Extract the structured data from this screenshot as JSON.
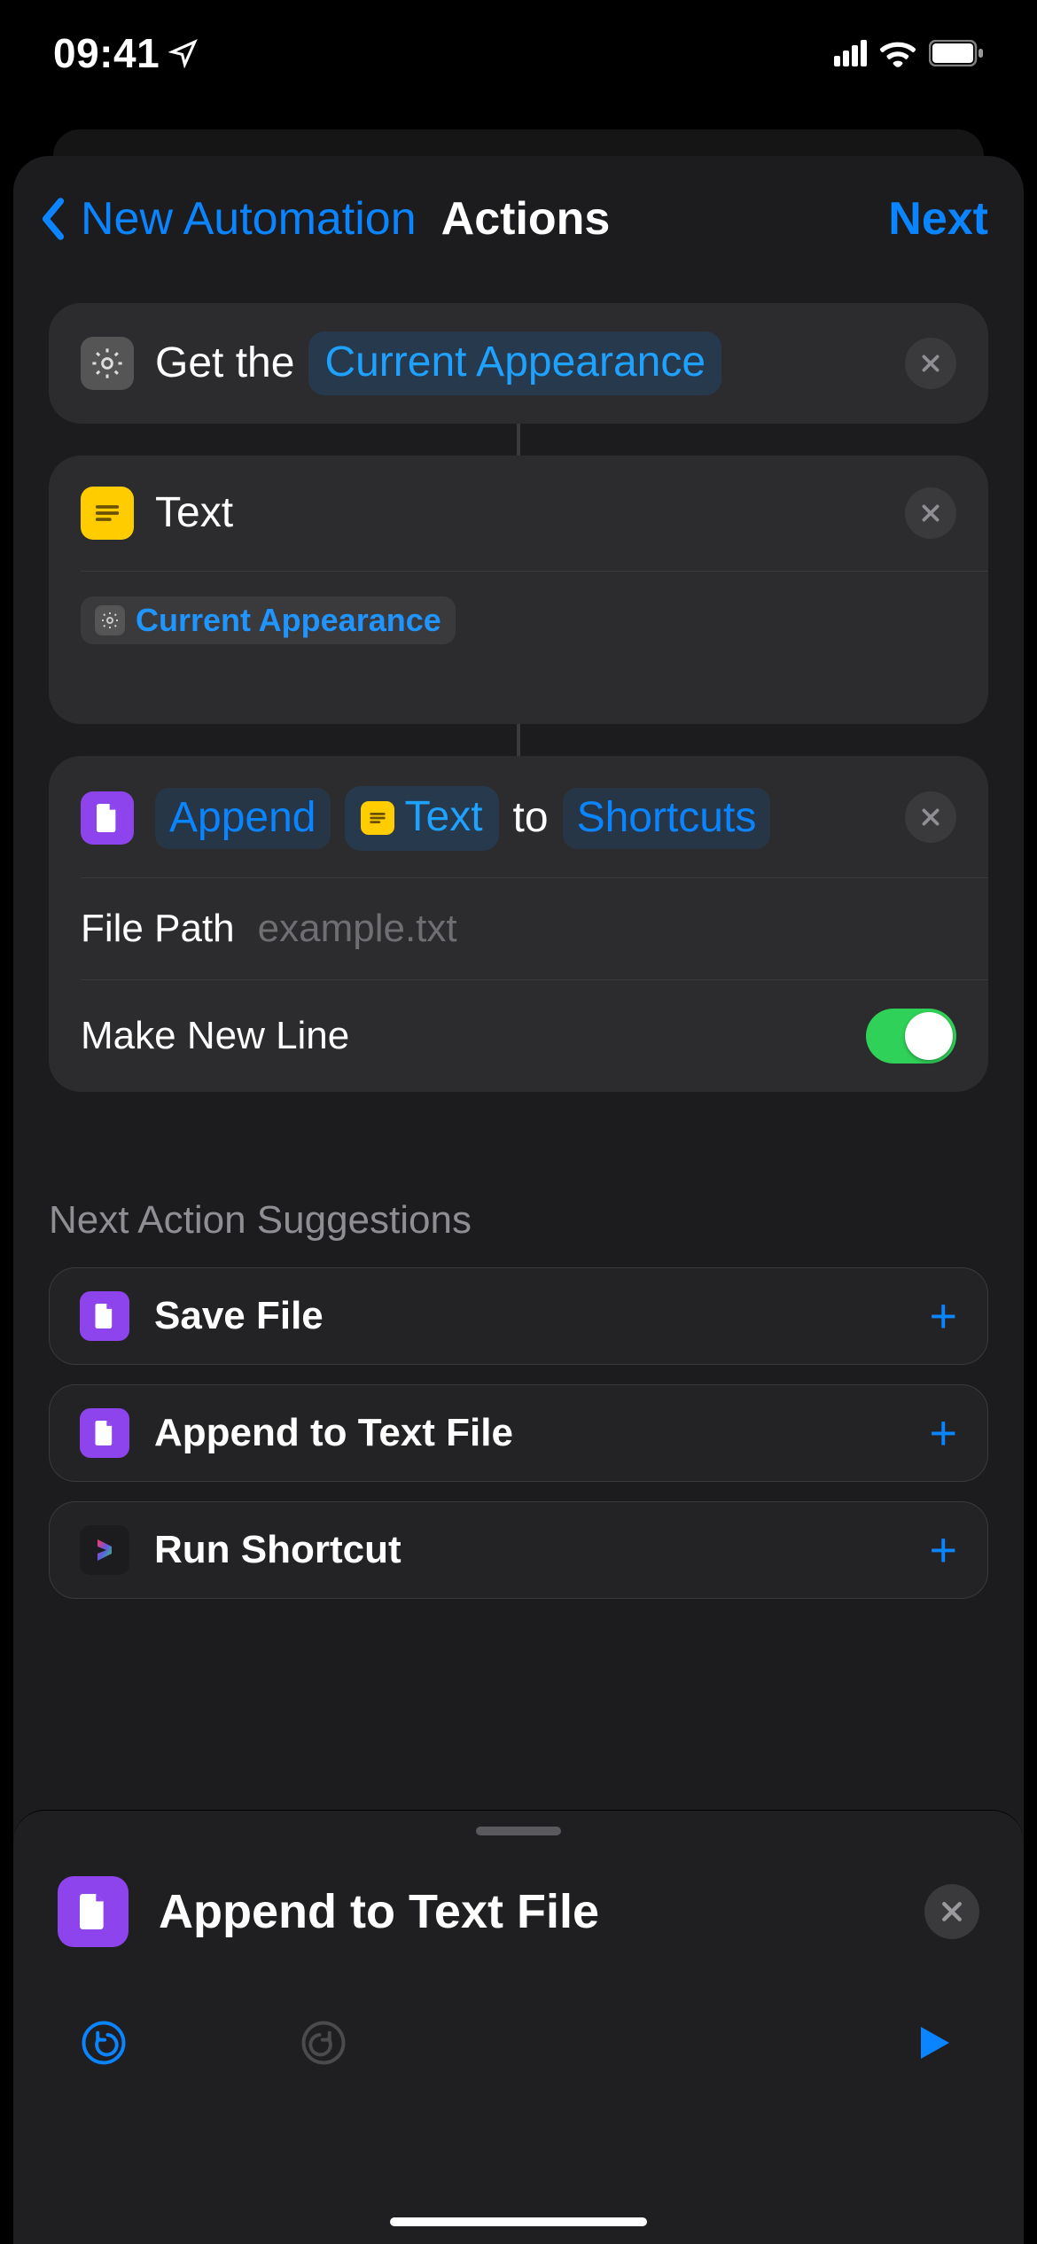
{
  "status": {
    "time": "09:41"
  },
  "nav": {
    "back_label": "New Automation",
    "title": "Actions",
    "next_label": "Next"
  },
  "actions": {
    "get_appearance": {
      "prefix": "Get the",
      "token": "Current Appearance"
    },
    "text": {
      "title": "Text",
      "chip_label": "Current Appearance"
    },
    "append": {
      "word_append": "Append",
      "token_text": "Text",
      "word_to": "to",
      "word_shortcuts": "Shortcuts",
      "file_path_label": "File Path",
      "file_path_placeholder": "example.txt",
      "new_line_label": "Make New Line"
    }
  },
  "suggestions": {
    "title": "Next Action Suggestions",
    "items": [
      {
        "label": "Save File"
      },
      {
        "label": "Append to Text File"
      },
      {
        "label": "Run Shortcut"
      }
    ]
  },
  "bottom": {
    "title": "Append to Text File"
  },
  "colors": {
    "accent": "#0a84ff",
    "green": "#30d158",
    "yellow": "#ffcc00",
    "purple": "#8e44ec"
  }
}
